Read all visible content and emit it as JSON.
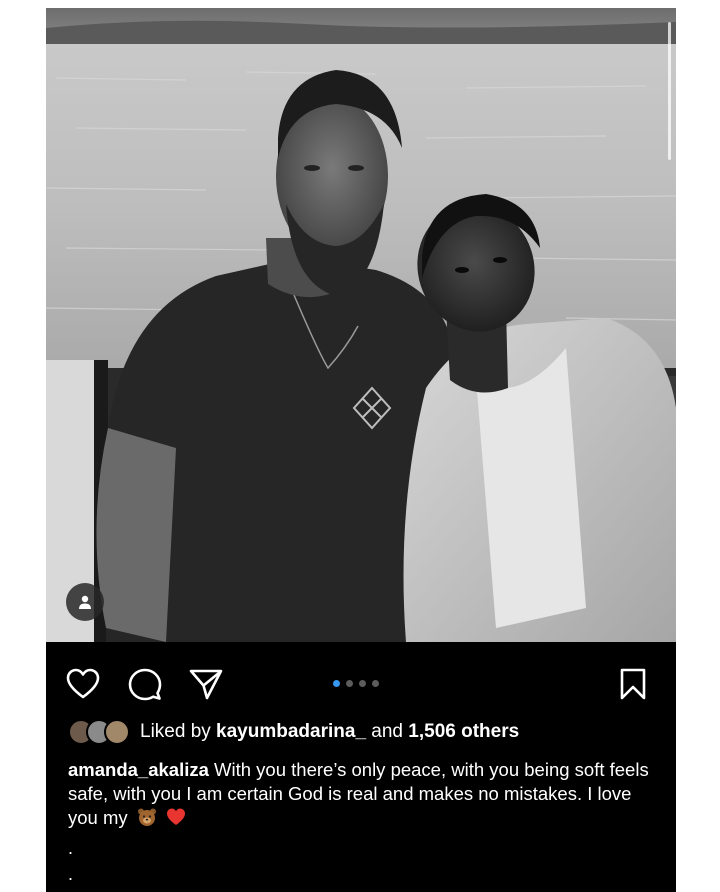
{
  "post": {
    "username": "amanda_akaliza",
    "caption": "With you there’s only peace, with you being soft feels safe, with you I am certain God is real and makes no mistakes. I love you my",
    "caption_emojis": [
      "bear-face-emoji",
      "red-heart-emoji"
    ],
    "caption_continuation": [
      ".",
      "."
    ]
  },
  "likes": {
    "prefix": "Liked by ",
    "liked_by_user": "kayumbadarina_",
    "conjunction": " and ",
    "count_text": "1,506 others"
  },
  "carousel": {
    "total": 4,
    "active_index": 0
  },
  "icons": {
    "like": "heart-icon",
    "comment": "comment-icon",
    "share": "paper-plane-icon",
    "save": "bookmark-icon",
    "tags": "person-tag-icon"
  },
  "colors": {
    "background": "#000000",
    "text": "#ffffff",
    "active_dot": "#3897f0",
    "inactive_dot": "#5c5c5c"
  }
}
